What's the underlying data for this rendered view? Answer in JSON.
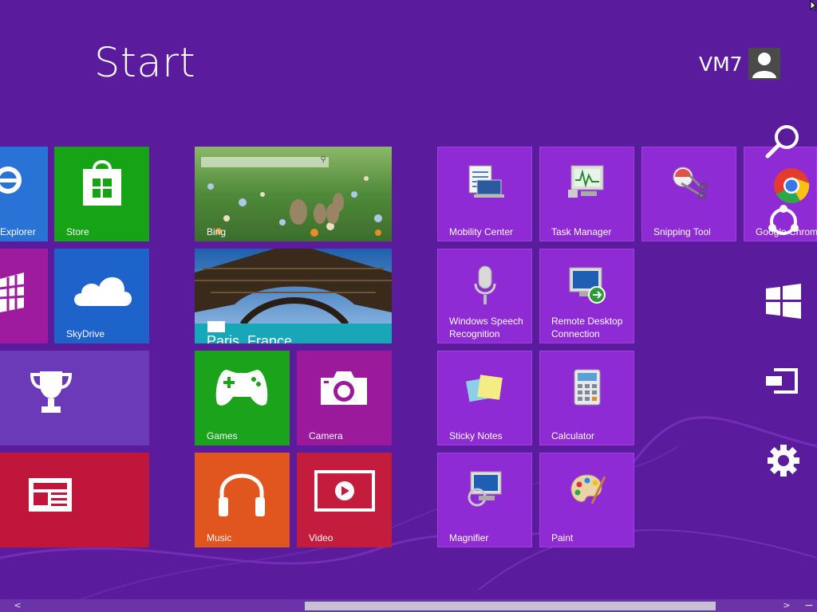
{
  "header": {
    "title": "Start",
    "user_name": "VM7"
  },
  "tiles": {
    "explorer": "Explorer",
    "store": "Store",
    "skydrive": "SkyDrive",
    "bing": "Bing",
    "travel": "Paris, France",
    "games": "Games",
    "camera": "Camera",
    "music": "Music",
    "video": "Video",
    "mobility_center": "Mobility Center",
    "task_manager": "Task Manager",
    "snipping_tool": "Snipping Tool",
    "chrome": "Google Chrome",
    "speech_line1": "Windows Speech",
    "speech_line2": "Recognition",
    "rdc_line1": "Remote Desktop",
    "rdc_line2": "Connection",
    "sticky_notes": "Sticky Notes",
    "calculator": "Calculator",
    "magnifier": "Magnifier",
    "paint": "Paint"
  },
  "charms": [
    "search-icon",
    "share-icon",
    "start-icon",
    "devices-icon",
    "settings-icon"
  ],
  "scrollbar": {
    "left_arrow": "<",
    "right_arrow": ">",
    "minus": "−"
  },
  "colors": {
    "background": "#5a1c9c",
    "tile_purple": "#8e2bd4",
    "store_green": "#16a316",
    "skydrive_blue": "#1e63c9",
    "games_green": "#1aa31b",
    "camera_magenta": "#9b1a9b",
    "music_orange": "#e0561e",
    "video_red": "#c41c3c",
    "news_red": "#c0163c",
    "magenta": "#9e1a9e",
    "trophy_purple": "#6a3ab8"
  }
}
